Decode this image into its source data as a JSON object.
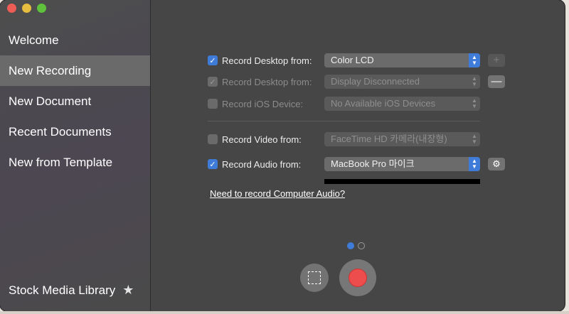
{
  "window": {
    "traffic_lights": [
      "close",
      "minimize",
      "zoom"
    ]
  },
  "sidebar": {
    "items": [
      {
        "label": "Welcome",
        "active": false
      },
      {
        "label": "New Recording",
        "active": true
      },
      {
        "label": "New Document",
        "active": false
      },
      {
        "label": "Recent Documents",
        "active": false
      },
      {
        "label": "New from Template",
        "active": false
      }
    ],
    "footer": {
      "label": "Stock Media Library",
      "icon": "star-icon"
    }
  },
  "recording": {
    "desktop1": {
      "label": "Record Desktop from:",
      "checked": true,
      "enabled": true,
      "value": "Color LCD",
      "button": "+"
    },
    "desktop2": {
      "label": "Record Desktop from:",
      "checked": true,
      "enabled": false,
      "value": "Display Disconnected",
      "button": "—"
    },
    "ios": {
      "label": "Record iOS Device:",
      "checked": false,
      "enabled": false,
      "value": "No Available iOS Devices"
    },
    "video": {
      "label": "Record Video from:",
      "checked": false,
      "enabled": false,
      "value": "FaceTime HD 카메라(내장형)"
    },
    "audio": {
      "label": "Record Audio from:",
      "checked": true,
      "enabled": true,
      "value": "MacBook Pro 마이크",
      "button_icon": "gear-icon"
    },
    "computer_audio_link": "Need to record Computer Audio?"
  },
  "pager": {
    "pages": 2,
    "current": 1
  },
  "colors": {
    "accent": "#3f7bd9",
    "record": "#ee4d4d"
  }
}
